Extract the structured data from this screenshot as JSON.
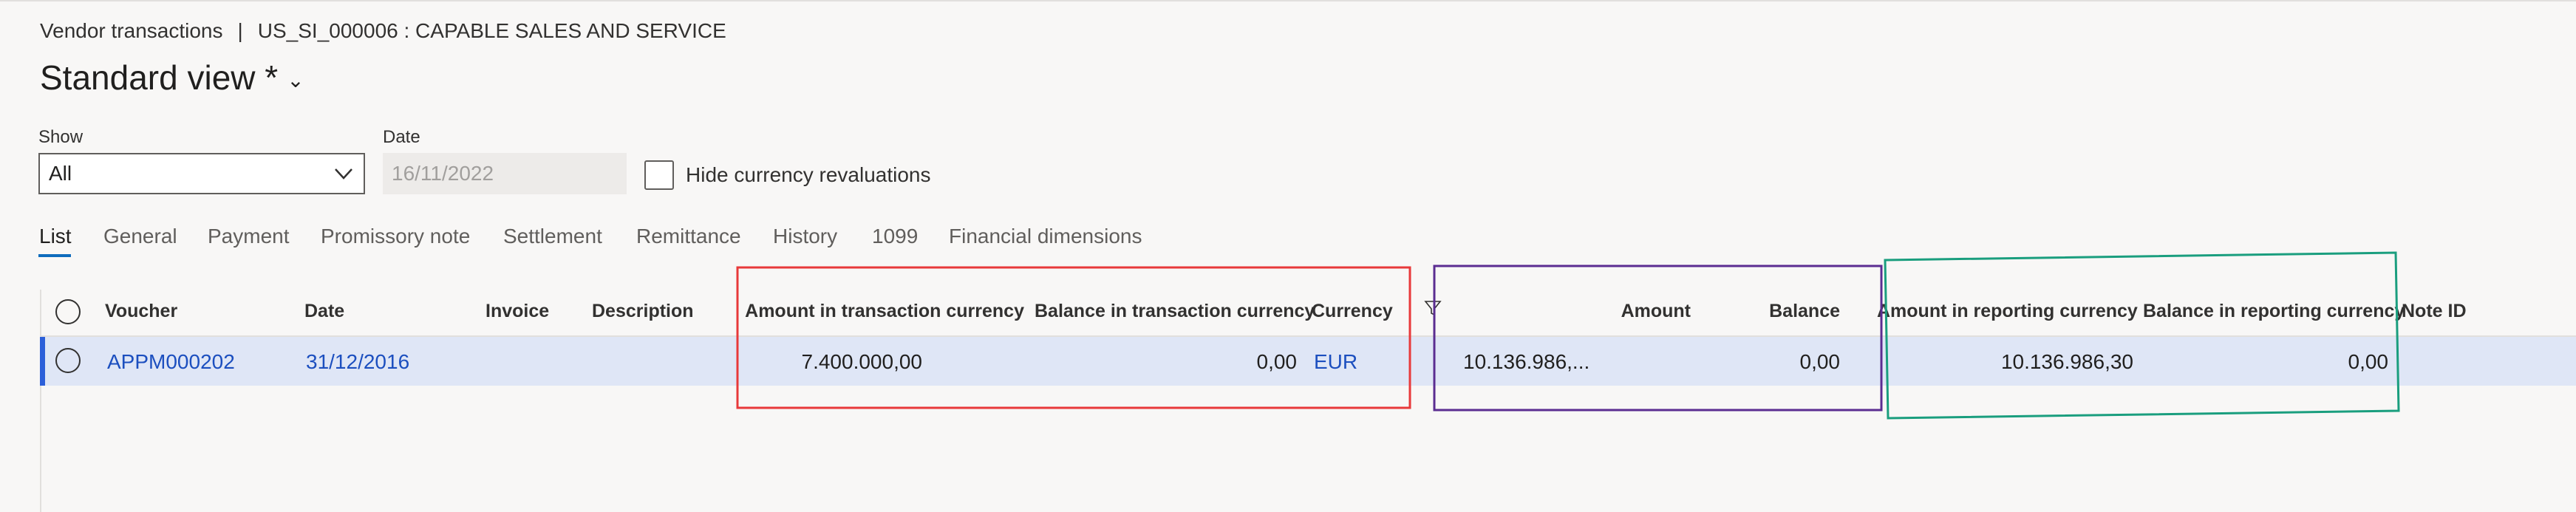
{
  "breadcrumb": {
    "page": "Vendor transactions",
    "separator": "|",
    "context": "US_SI_000006 : CAPABLE SALES AND SERVICE"
  },
  "view": {
    "title": "Standard view *"
  },
  "filters": {
    "show_label": "Show",
    "show_value": "All",
    "date_label": "Date",
    "date_value": "16/11/2022",
    "hide_revaluations_label": "Hide currency revaluations",
    "hide_revaluations_checked": false
  },
  "tabs": [
    {
      "label": "List",
      "active": true
    },
    {
      "label": "General"
    },
    {
      "label": "Payment"
    },
    {
      "label": "Promissory note"
    },
    {
      "label": "Settlement"
    },
    {
      "label": "Remittance"
    },
    {
      "label": "History"
    },
    {
      "label": "1099"
    },
    {
      "label": "Financial dimensions"
    }
  ],
  "grid": {
    "columns": {
      "voucher": "Voucher",
      "date": "Date",
      "invoice": "Invoice",
      "description": "Description",
      "amount_tx": "Amount in transaction currency",
      "balance_tx": "Balance in transaction currency",
      "currency": "Currency",
      "amount": "Amount",
      "balance": "Balance",
      "amount_rep": "Amount in reporting currency",
      "balance_rep": "Balance in reporting currency",
      "note_id": "Note ID"
    },
    "rows": [
      {
        "voucher": "APPM000202",
        "date": "31/12/2016",
        "invoice": "",
        "description": "",
        "amount_tx": "7.400.000,00",
        "balance_tx": "0,00",
        "currency": "EUR",
        "amount": "10.136.986,...",
        "balance": "0,00",
        "amount_rep": "10.136.986,30",
        "balance_rep": "0,00",
        "note_id": ""
      }
    ]
  },
  "colors": {
    "annotation_transaction": "#e8393a",
    "annotation_accounting": "#5b2d91",
    "annotation_reporting": "#1a9e7e",
    "selected_row": "#dfe6f6",
    "link": "#1c4fbf"
  },
  "icons": [
    "chevron-down-icon",
    "radio-select-all-icon",
    "radio-row-icon",
    "filter-icon"
  ]
}
